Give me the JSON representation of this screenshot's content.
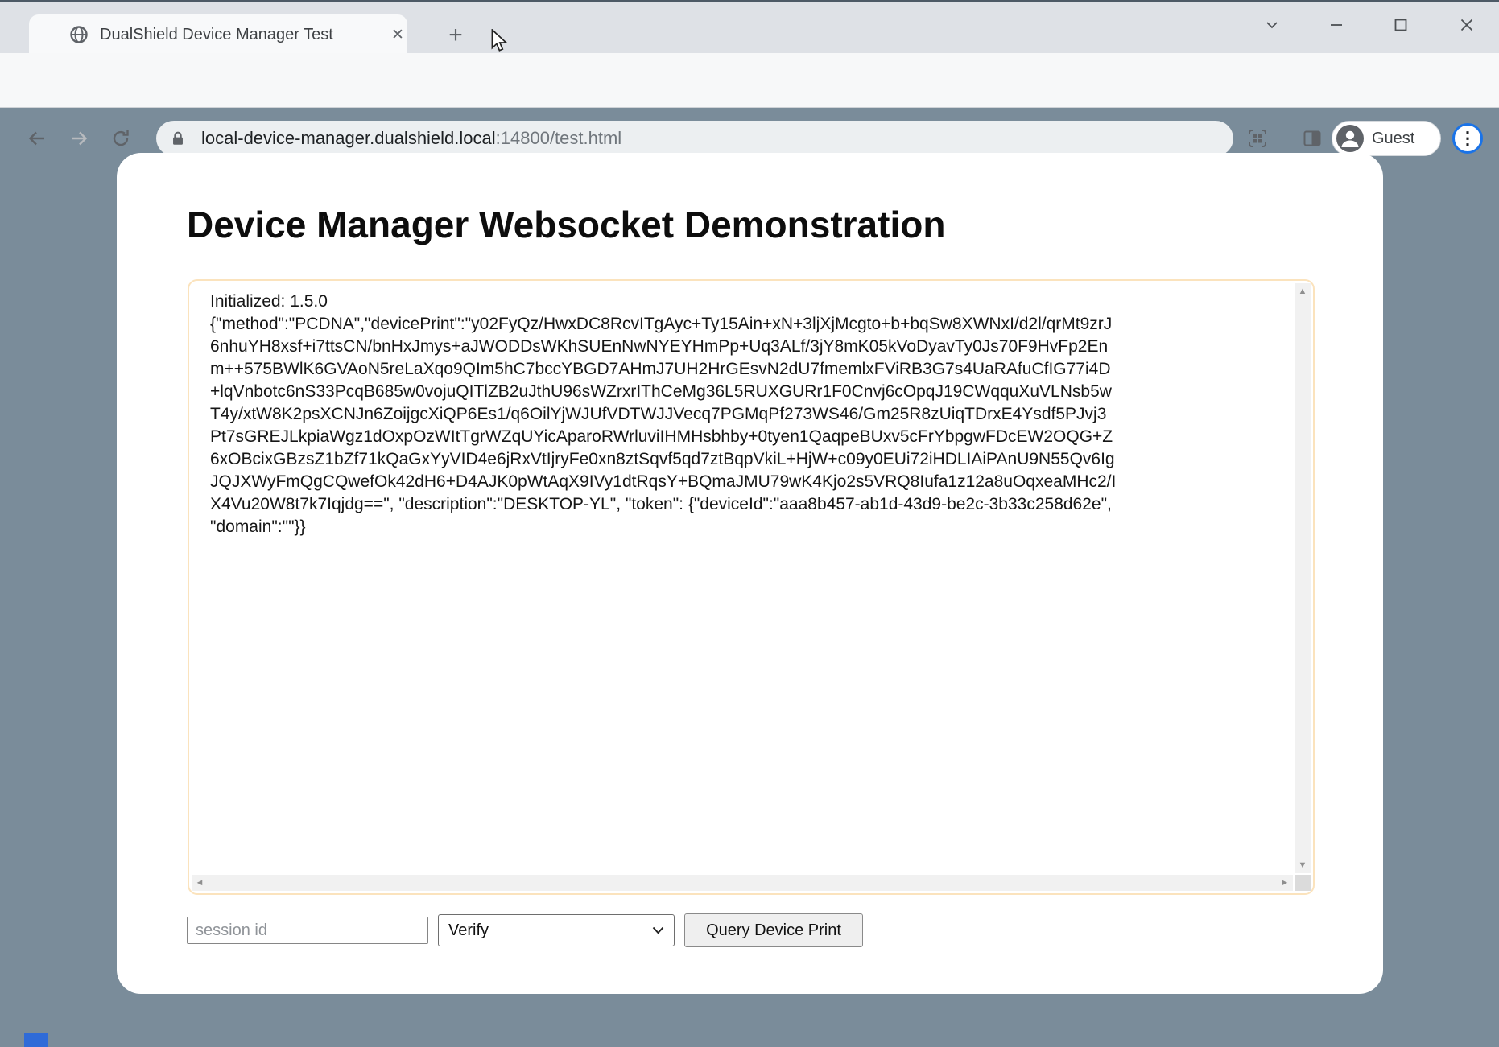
{
  "browser": {
    "tab_title": "DualShield Device Manager Test",
    "url_host": "local-device-manager.dualshield.local",
    "url_path": ":14800/test.html",
    "profile_label": "Guest"
  },
  "page": {
    "heading": "Device Manager Websocket Demonstration",
    "log_text": "Initialized: 1.5.0\n{\"method\":\"PCDNA\",\"devicePrint\":\"y02FyQz/HwxDC8RcvITgAyc+Ty15Ain+xN+3ljXjMcgto+b+bqSw8XWNxI/d2l/qrMt9zrJ\n6nhuYH8xsf+i7ttsCN/bnHxJmys+aJWODDsWKhSUEnNwNYEYHmPp+Uq3ALf/3jY8mK05kVoDyavTy0Js70F9HvFp2En\nm++575BWlK6GVAoN5reLaXqo9QIm5hC7bccYBGD7AHmJ7UH2HrGEsvN2dU7fmemlxFViRB3G7s4UaRAfuCfIG77i4D\n+lqVnbotc6nS33PcqB685w0vojuQITlZB2uJthU96sWZrxrIThCeMg36L5RUXGURr1F0Cnvj6cOpqJ19CWqquXuVLNsb5w\nT4y/xtW8K2psXCNJn6ZoijgcXiQP6Es1/q6OilYjWJUfVDTWJJVecq7PGMqPf273WS46/Gm25R8zUiqTDrxE4Ysdf5PJvj3\nPt7sGREJLkpiaWgz1dOxpOzWItTgrWZqUYicAparoRWrluviIHMHsbhby+0tyen1QaqpeBUxv5cFrYbpgwFDcEW2OQG+Z\n6xOBcixGBzsZ1bZf71kQaGxYyVID4e6jRxVtIjryFe0xn8ztSqvf5qd7ztBqpVkiL+HjW+c09y0EUi72iHDLIAiPAnU9N55Qv6Ig\nJQJXWyFmQgCQwefOk42dH6+D4AJK0pWtAqX9IVy1dtRqsY+BQmaJMU79wK4Kjo2s5VRQ8Iufa1z12a8uOqxeaMHc2/I\nX4Vu20W8t7k7Iqjdg==\", \"description\":\"DESKTOP-YL\", \"token\": {\"deviceId\":\"aaa8b457-ab1d-43d9-be2c-3b33c258d62e\",\n\"domain\":\"\"}}",
    "session_placeholder": "session id",
    "action_selected": "Verify",
    "query_button_label": "Query Device Print"
  },
  "icons": {
    "tab_close": "✕",
    "new_tab": "+",
    "menu_overflow": "⋮",
    "scroll_up": "▲",
    "scroll_down": "▼",
    "scroll_left": "◄",
    "scroll_right": "►"
  },
  "colors": {
    "page_background": "#7a8c9a",
    "log_border": "#fbe3bd",
    "profile_ring_blue": "#1a73e8",
    "tabstrip_background": "#dee1e6"
  }
}
